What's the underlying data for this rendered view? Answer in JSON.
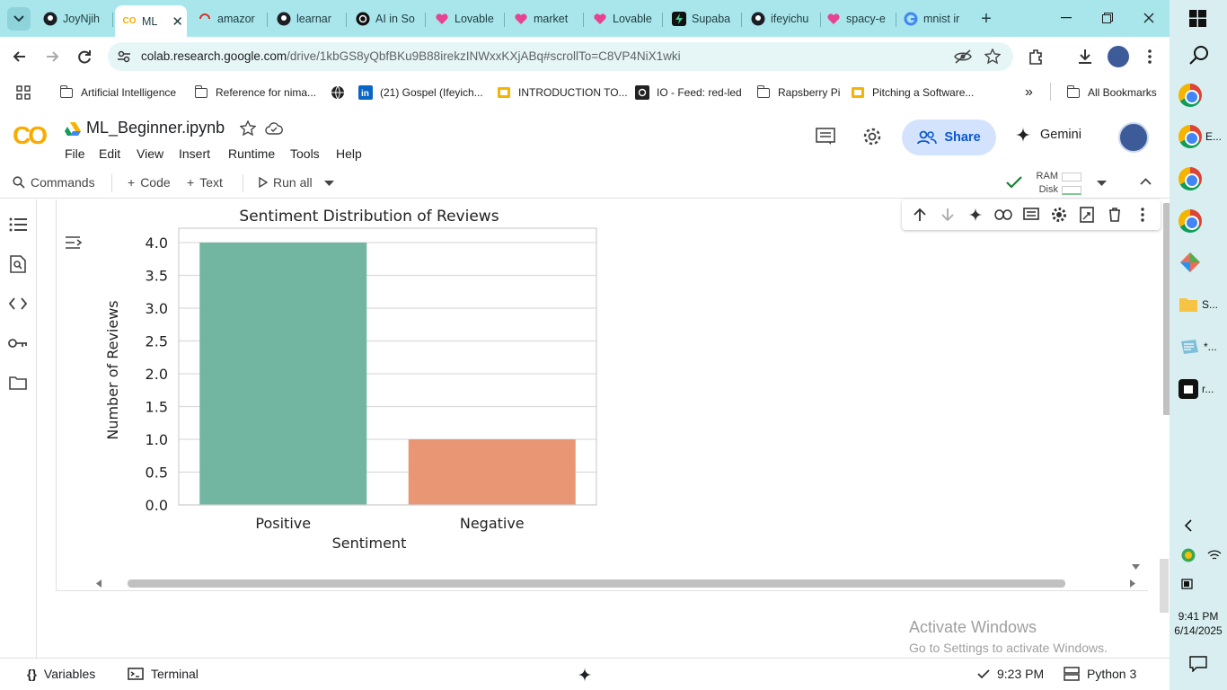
{
  "browser": {
    "tabs": [
      {
        "label": "JoyNjih",
        "icon": "github-icon"
      },
      {
        "label": "ML",
        "icon": "colab-icon",
        "active": true
      },
      {
        "label": "amazor",
        "icon": "loading-icon"
      },
      {
        "label": "learnar",
        "icon": "github-icon"
      },
      {
        "label": "AI in So",
        "icon": "openai-icon"
      },
      {
        "label": "Lovable",
        "icon": "lovable-icon"
      },
      {
        "label": "market",
        "icon": "lovable-icon"
      },
      {
        "label": "Lovable",
        "icon": "lovable-icon"
      },
      {
        "label": "Supaba",
        "icon": "supabase-icon"
      },
      {
        "label": "ifeyichu",
        "icon": "github-icon"
      },
      {
        "label": "spacy-e",
        "icon": "lovable-icon"
      },
      {
        "label": "mnist ir",
        "icon": "google-icon"
      }
    ],
    "url_host": "colab.research.google.com",
    "url_path": "/drive/1kbGS8yQbfBKu9B88irekzINWxxKXjABq#scrollTo=C8VP4NiX1wki",
    "bookmarks": [
      {
        "label": "Artificial Intelligence",
        "icon": "folder-icon"
      },
      {
        "label": "Reference for nima...",
        "icon": "folder-icon"
      },
      {
        "label": "",
        "icon": "globe-icon"
      },
      {
        "label": "(21) Gospel (Ifeyich...",
        "icon": "linkedin-icon"
      },
      {
        "label": "INTRODUCTION TO...",
        "icon": "slides-icon"
      },
      {
        "label": "IO - Feed: red-led",
        "icon": "io-icon"
      },
      {
        "label": "Rapsberry Pi",
        "icon": "folder-icon"
      },
      {
        "label": "Pitching a Software...",
        "icon": "slides-icon"
      }
    ],
    "more_bookmarks": "»",
    "all_bookmarks": "All Bookmarks"
  },
  "colab": {
    "logo": "CO",
    "notebook_title": "ML_Beginner.ipynb",
    "menu": [
      "File",
      "Edit",
      "View",
      "Insert",
      "Runtime",
      "Tools",
      "Help"
    ],
    "share_label": "Share",
    "gemini_label": "Gemini",
    "toolbar": {
      "commands": "Commands",
      "code": "Code",
      "text": "Text",
      "run_all": "Run all",
      "ram": "RAM",
      "disk": "Disk"
    }
  },
  "chart_data": {
    "type": "bar",
    "title": "Sentiment Distribution of Reviews",
    "xlabel": "Sentiment",
    "ylabel": "Number of Reviews",
    "categories": [
      "Positive",
      "Negative"
    ],
    "values": [
      4,
      1
    ],
    "colors": [
      "#72b6a1",
      "#e99675"
    ],
    "ylim": [
      0,
      4
    ],
    "yticks": [
      "0.0",
      "0.5",
      "1.0",
      "1.5",
      "2.0",
      "2.5",
      "3.0",
      "3.5",
      "4.0"
    ],
    "grid": true
  },
  "watermark": {
    "line1": "Activate Windows",
    "line2": "Go to Settings to activate Windows."
  },
  "statusbar": {
    "variables": "Variables",
    "terminal": "Terminal",
    "exec_time": "9:23 PM",
    "kernel": "Python 3"
  },
  "taskbar": {
    "labels": [
      "E...",
      "S...",
      "*...",
      "r..."
    ],
    "time": "9:41 PM",
    "date": "6/14/2025"
  }
}
